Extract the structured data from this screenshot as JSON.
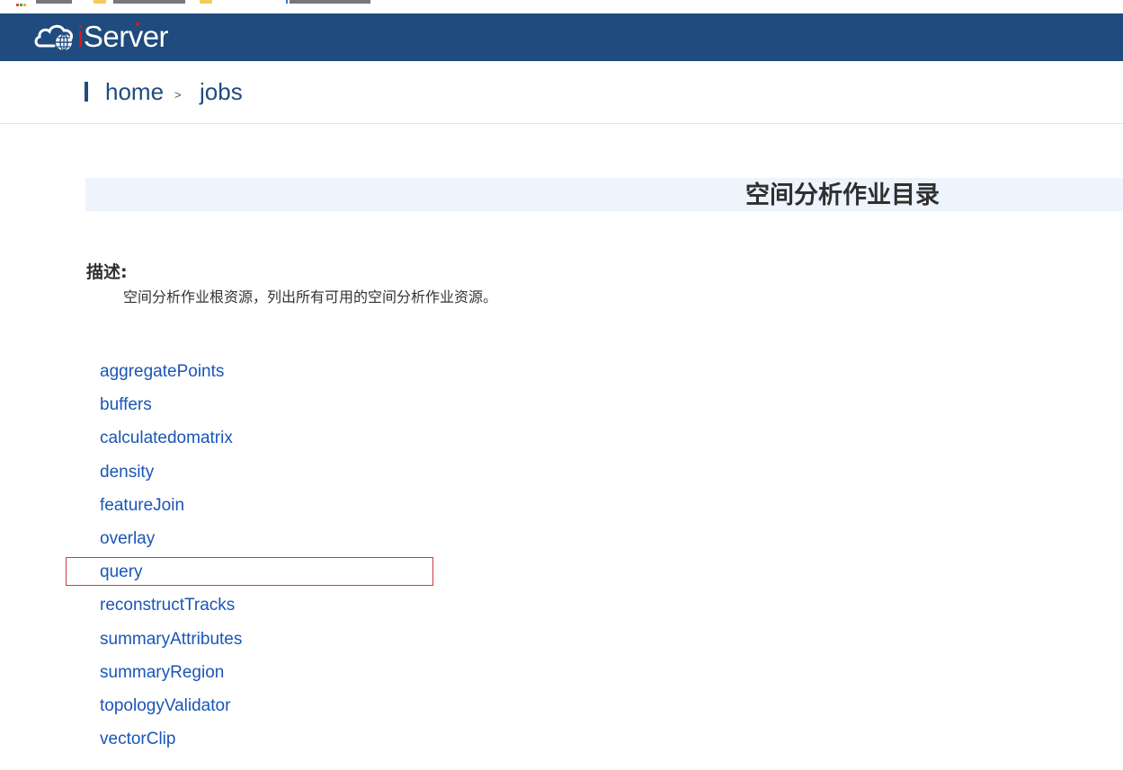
{
  "app": {
    "logo_text": "iServer"
  },
  "breadcrumb": {
    "home_label": "home",
    "separator": ">",
    "current_label": "jobs"
  },
  "page": {
    "title": "空间分析作业目录",
    "description_label": "描述:",
    "description_text": "空间分析作业根资源，列出所有可用的空间分析作业资源。"
  },
  "jobs": {
    "items": [
      "aggregatePoints",
      "buffers",
      "calculatedomatrix",
      "density",
      "featureJoin",
      "overlay",
      "query",
      "reconstructTracks",
      "summaryAttributes",
      "summaryRegion",
      "topologyValidator",
      "vectorClip"
    ],
    "highlighted": "query"
  },
  "colors": {
    "header_bg": "#1f4b7e",
    "link": "#1a56b6",
    "title_band": "#eef4fb",
    "highlight_border": "#d0383c",
    "logo_accent": "#d71920"
  },
  "icons": {
    "logo": "cloud-globe-icon",
    "breadcrumb_marker": "vertical-bar"
  }
}
